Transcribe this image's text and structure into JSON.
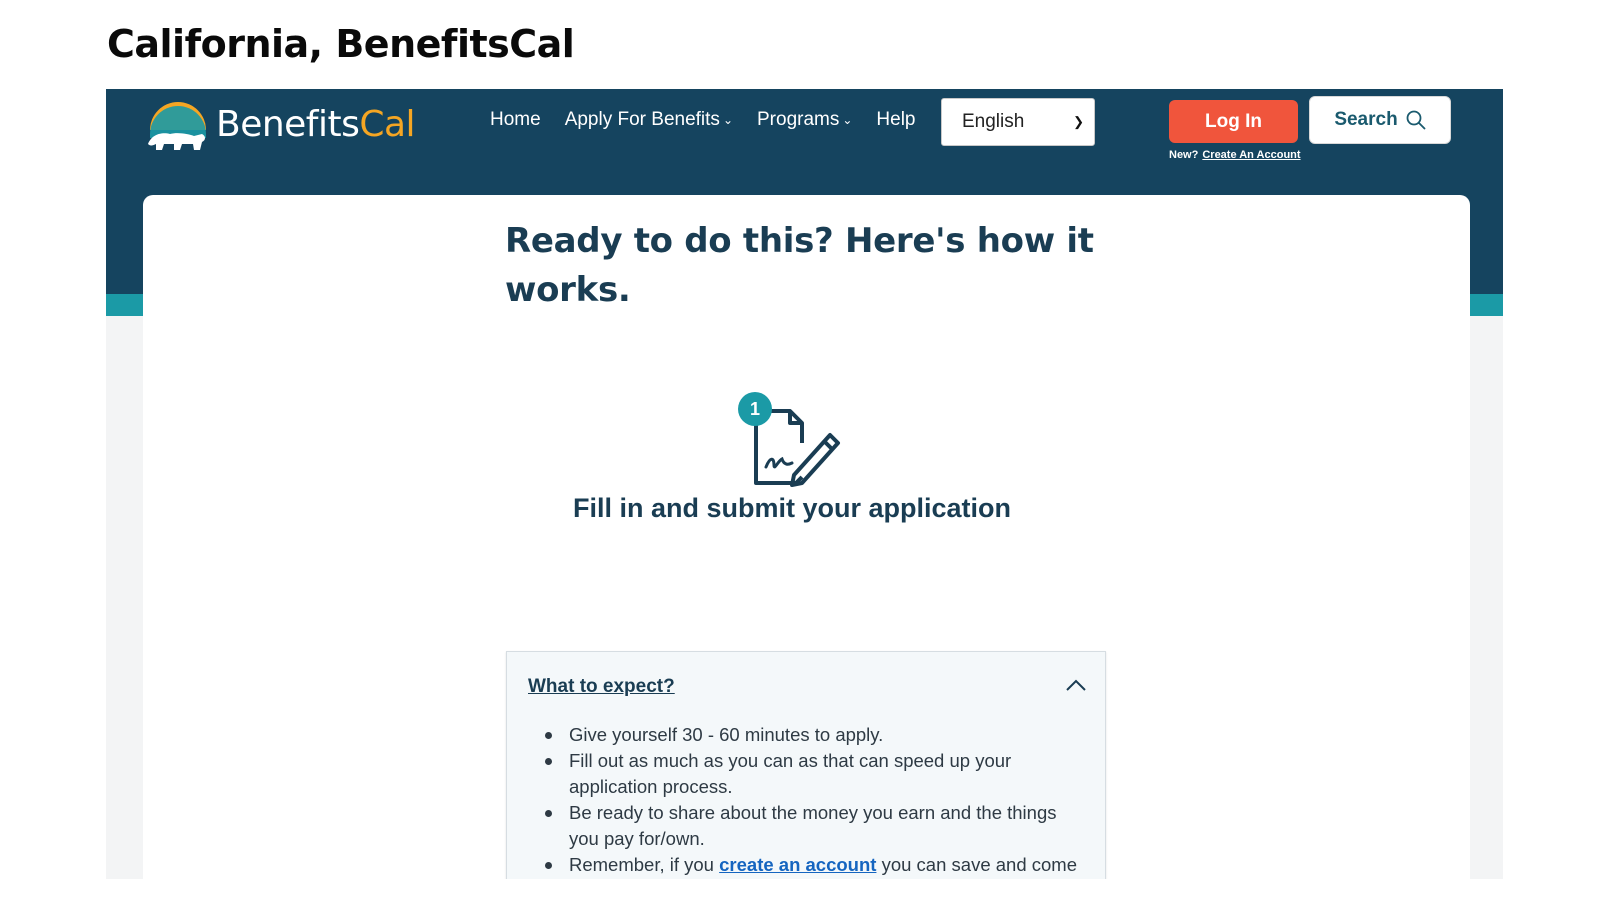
{
  "slide": {
    "title": "California, BenefitsCal"
  },
  "header": {
    "logo": {
      "word_main": "Benefits",
      "word_accent": "Cal",
      "icon": "bear-sun-logo-icon"
    },
    "nav": [
      {
        "label": "Home",
        "has_dropdown": false
      },
      {
        "label": "Apply For Benefits",
        "has_dropdown": true
      },
      {
        "label": "Programs",
        "has_dropdown": true
      },
      {
        "label": "Help",
        "has_dropdown": false
      }
    ],
    "language": {
      "selected": "English"
    },
    "login_label": "Log In",
    "new_label": "New?",
    "create_account_label": "Create An Account",
    "search_label": "Search"
  },
  "main": {
    "headline": "Ready to do this? Here's how it works.",
    "step": {
      "number": "1",
      "icon": "document-sign-icon",
      "title": "Fill in and submit your application"
    },
    "expect": {
      "title": "What to expect?",
      "expanded": true,
      "items": [
        {
          "text": "Give yourself 30 - 60 minutes to apply."
        },
        {
          "text": "Fill out as much as you can as that can speed up your application process."
        },
        {
          "text": "Be ready to share about the money you earn and the things you pay for/own."
        },
        {
          "pre": "Remember, if you ",
          "link": "create an account",
          "post": " you can save and come back later to finish."
        }
      ]
    }
  },
  "colors": {
    "header": "#15445f",
    "teal": "#1b9aa6",
    "login": "#f0553c",
    "accent": "#f5a623",
    "heading": "#1a3d53",
    "link": "#1565c0"
  }
}
